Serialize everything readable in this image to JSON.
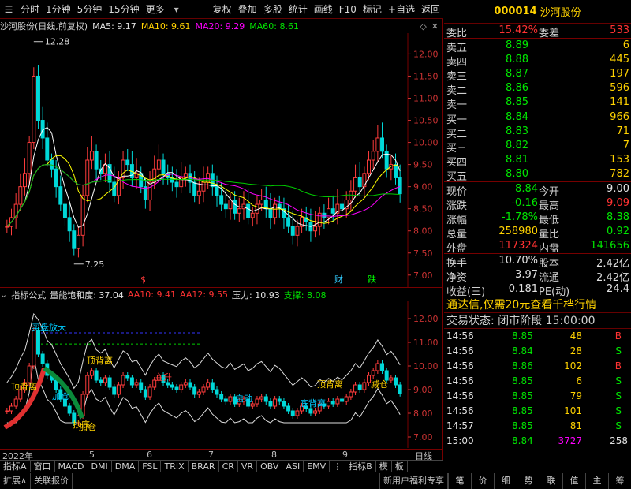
{
  "toolbar": {
    "left_items": [
      "分时",
      "1分钟",
      "5分钟",
      "15分钟",
      "更多"
    ],
    "right_items": [
      "复权",
      "叠加",
      "多股",
      "统计",
      "画线",
      "F10",
      "标记",
      "+自选",
      "返回"
    ]
  },
  "price_panel": {
    "stock_label": "沙河股份(日线,前复权)",
    "ma5": "MA5: 9.17",
    "ma10": "MA10: 9.61",
    "ma20": "MA20: 9.29",
    "ma60": "MA60: 8.61",
    "y_ticks": [
      "12.00",
      "11.50",
      "11.00",
      "10.50",
      "10.00",
      "9.50",
      "9.00",
      "8.50",
      "8.00",
      "7.50",
      "7.00"
    ],
    "high_label": "12.28",
    "low_label": "7.25",
    "markers": [
      "$",
      "财",
      "跌"
    ]
  },
  "indicator_panel": {
    "name": "指标公式",
    "line1": "量能饱和度: 37.04",
    "line2": "AA10: 9.41",
    "line3": "AA12: 9.55",
    "line4": "压力: 10.93",
    "line5": "支撑: 8.08",
    "y_ticks": [
      "12.00",
      "11.00",
      "10.00",
      "9.00",
      "8.00",
      "7.00"
    ],
    "signal_labels": [
      "顶背离",
      "抄底",
      "加仓",
      "买盘放大",
      "顶背离",
      "主升",
      "底背离",
      "启动",
      "顶背离",
      "减仓",
      "加仓"
    ]
  },
  "date_axis": {
    "labels": [
      "2022年",
      "5",
      "6",
      "7",
      "8",
      "9"
    ],
    "right_label": "日线"
  },
  "tabs": [
    "指标A",
    "窗口",
    "MACD",
    "DMI",
    "DMA",
    "FSL",
    "TRIX",
    "BRAR",
    "CR",
    "VR",
    "OBV",
    "ASI",
    "EMV",
    "指标B",
    "模",
    "板"
  ],
  "bottom_bar": {
    "left": [
      "扩展∧",
      "关联报价"
    ],
    "center": "新用户福利专享",
    "nav": [
      "笔",
      "价",
      "细",
      "势",
      "联",
      "值",
      "主",
      "筹"
    ]
  },
  "quote": {
    "code": "000014",
    "name": "沙河股份",
    "weibi_label": "委比",
    "weibi_value": "15.42%",
    "weicha_label": "委差",
    "weicha_value": "533",
    "sell": [
      {
        "label": "卖五",
        "price": "8.89",
        "vol": "6"
      },
      {
        "label": "卖四",
        "price": "8.88",
        "vol": "445"
      },
      {
        "label": "卖三",
        "price": "8.87",
        "vol": "197"
      },
      {
        "label": "卖二",
        "price": "8.86",
        "vol": "596"
      },
      {
        "label": "卖一",
        "price": "8.85",
        "vol": "141"
      }
    ],
    "buy": [
      {
        "label": "买一",
        "price": "8.84",
        "vol": "966"
      },
      {
        "label": "买二",
        "price": "8.83",
        "vol": "71"
      },
      {
        "label": "买三",
        "price": "8.82",
        "vol": "7"
      },
      {
        "label": "买四",
        "price": "8.81",
        "vol": "153"
      },
      {
        "label": "买五",
        "price": "8.80",
        "vol": "782"
      }
    ],
    "stats": [
      {
        "l1": "现价",
        "v1": "8.84",
        "c1": "green",
        "l2": "今开",
        "v2": "9.00",
        "c2": "white"
      },
      {
        "l1": "涨跌",
        "v1": "-0.16",
        "c1": "green",
        "l2": "最高",
        "v2": "9.09",
        "c2": "red"
      },
      {
        "l1": "涨幅",
        "v1": "-1.78%",
        "c1": "green",
        "l2": "最低",
        "v2": "8.38",
        "c2": "green"
      },
      {
        "l1": "总量",
        "v1": "258980",
        "c1": "yellow",
        "l2": "量比",
        "v2": "0.92",
        "c2": "green"
      },
      {
        "l1": "外盘",
        "v1": "117324",
        "c1": "red",
        "l2": "内盘",
        "v2": "141656",
        "c2": "green"
      }
    ],
    "stats2": [
      {
        "l1": "换手",
        "v1": "10.70%",
        "l2": "股本",
        "v2": "2.42亿"
      },
      {
        "l1": "净资",
        "v1": "3.97",
        "l2": "流通",
        "v2": "2.42亿"
      },
      {
        "l1": "收益(三)",
        "v1": "0.181",
        "l2": "PE(动)",
        "v2": "24.4"
      }
    ],
    "banner": "通达信,仅需20元查看千档行情",
    "status_label": "交易状态: 闭市阶段 15:00:00",
    "ticks": [
      {
        "t": "14:56",
        "p": "8.85",
        "v": "48",
        "bs": "B"
      },
      {
        "t": "14:56",
        "p": "8.84",
        "v": "28",
        "bs": "S"
      },
      {
        "t": "14:56",
        "p": "8.86",
        "v": "102",
        "bs": "B"
      },
      {
        "t": "14:56",
        "p": "8.85",
        "v": "6",
        "bs": "S"
      },
      {
        "t": "14:56",
        "p": "8.85",
        "v": "79",
        "bs": "S"
      },
      {
        "t": "14:56",
        "p": "8.85",
        "v": "101",
        "bs": "S"
      },
      {
        "t": "14:57",
        "p": "8.85",
        "v": "81",
        "bs": "S"
      },
      {
        "t": "15:00",
        "p": "8.84",
        "v": "3727",
        "bs": "258"
      }
    ]
  },
  "chart_data": {
    "type": "candlestick",
    "ylim": [
      6.8,
      12.4
    ],
    "closes": [
      8.1,
      8.3,
      8.6,
      9.0,
      9.3,
      10.0,
      11.5,
      10.5,
      10.1,
      9.6,
      9.4,
      9.0,
      8.6,
      8.3,
      8.0,
      7.6,
      7.9,
      8.8,
      9.6,
      9.8,
      9.4,
      9.3,
      9.5,
      9.1,
      8.8,
      9.2,
      9.6,
      9.5,
      9.2,
      9.3,
      9.0,
      8.7,
      9.1,
      9.4,
      9.6,
      9.3,
      9.2,
      9.1,
      9.0,
      9.2,
      9.3,
      9.1,
      8.8,
      8.9,
      9.1,
      9.3,
      9.0,
      8.8,
      8.6,
      8.5,
      8.7,
      8.4,
      8.5,
      8.6,
      8.3,
      8.4,
      8.6,
      8.7,
      8.5,
      8.3,
      8.6,
      8.5,
      8.3,
      8.1,
      7.9,
      8.1,
      8.3,
      8.2,
      8.0,
      8.1,
      8.4,
      8.3,
      8.5,
      8.4,
      8.6,
      8.5,
      8.7,
      8.9,
      9.2,
      9.0,
      9.3,
      9.6,
      9.8,
      10.1,
      9.8,
      9.4,
      9.5,
      9.2,
      8.84
    ],
    "ma_series": [
      {
        "name": "MA5",
        "color": "#ffffff"
      },
      {
        "name": "MA10",
        "color": "#ffff00"
      },
      {
        "name": "MA20",
        "color": "#ff00ff"
      },
      {
        "name": "MA60",
        "color": "#00cc00"
      }
    ],
    "indicator_ylim": [
      6.6,
      12.6
    ],
    "resistance": 10.93,
    "support": 8.08
  }
}
